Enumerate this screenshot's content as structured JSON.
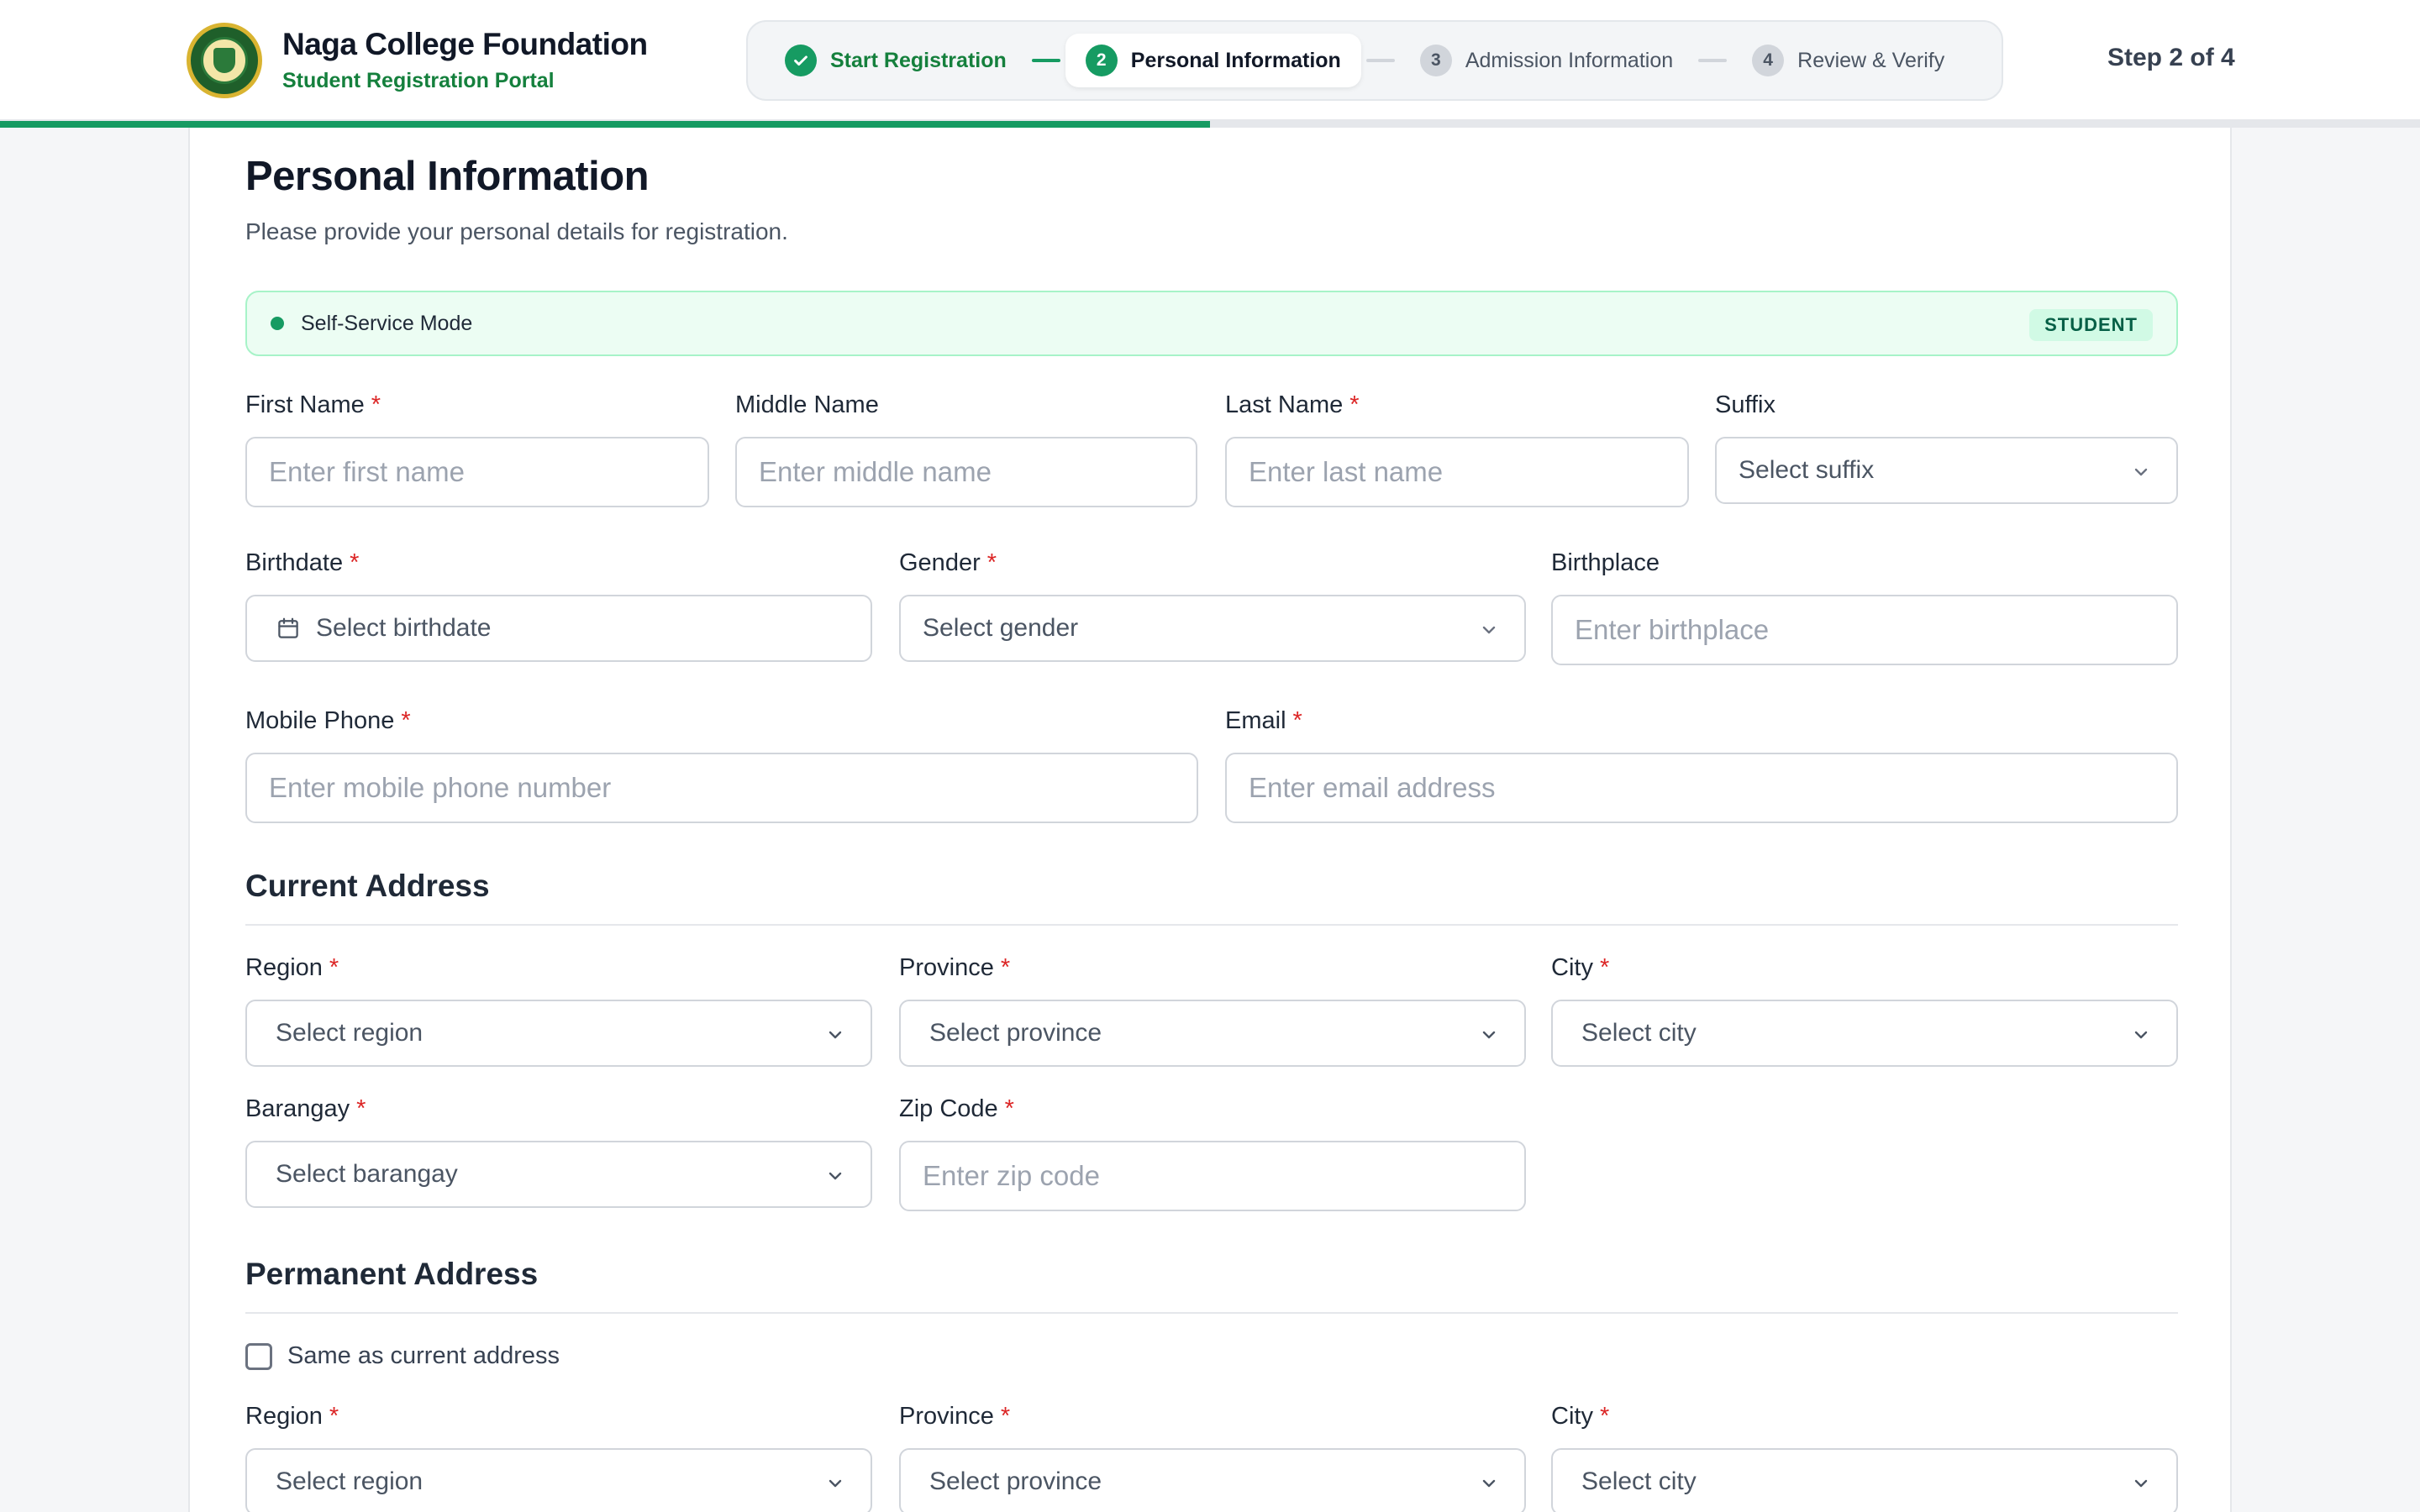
{
  "header": {
    "brand_title": "Naga College Foundation",
    "brand_subtitle": "Student Registration Portal",
    "step_counter": "Step 2 of 4",
    "progress": 0.5,
    "steps": [
      {
        "number": "1",
        "label": "Start Registration",
        "state": "done"
      },
      {
        "number": "2",
        "label": "Personal Information",
        "state": "active"
      },
      {
        "number": "3",
        "label": "Admission Information",
        "state": "todo"
      },
      {
        "number": "4",
        "label": "Review & Verify",
        "state": "todo"
      }
    ]
  },
  "page": {
    "title": "Personal Information",
    "description": "Please provide your personal details for registration."
  },
  "mode": {
    "label": "Self-Service Mode",
    "badge": "STUDENT"
  },
  "personal": {
    "first_name": {
      "label": "First Name",
      "placeholder": "Enter first name"
    },
    "middle_name": {
      "label": "Middle Name",
      "placeholder": "Enter middle name"
    },
    "last_name": {
      "label": "Last Name",
      "placeholder": "Enter last name"
    },
    "suffix": {
      "label": "Suffix",
      "value": "Select suffix"
    },
    "birthdate": {
      "label": "Birthdate",
      "value": "Select birthdate"
    },
    "gender": {
      "label": "Gender",
      "value": "Select gender"
    },
    "birthplace": {
      "label": "Birthplace",
      "placeholder": "Enter birthplace"
    },
    "mobile": {
      "label": "Mobile Phone",
      "placeholder": "Enter mobile phone number"
    },
    "email": {
      "label": "Email",
      "placeholder": "Enter email address"
    }
  },
  "current_address": {
    "title": "Current Address",
    "region": {
      "label": "Region",
      "value": "Select region"
    },
    "province": {
      "label": "Province",
      "value": "Select province"
    },
    "city": {
      "label": "City",
      "value": "Select city"
    },
    "barangay": {
      "label": "Barangay",
      "value": "Select barangay"
    },
    "zip": {
      "label": "Zip Code",
      "placeholder": "Enter zip code"
    }
  },
  "permanent_address": {
    "title": "Permanent Address",
    "same_as_current": "Same as current address",
    "region": {
      "label": "Region",
      "value": "Select region"
    },
    "province": {
      "label": "Province",
      "value": "Select province"
    },
    "city": {
      "label": "City",
      "value": "Select city"
    }
  },
  "required_mark": "*",
  "colors": {
    "accent": "#169b62",
    "required": "#dc2626"
  }
}
